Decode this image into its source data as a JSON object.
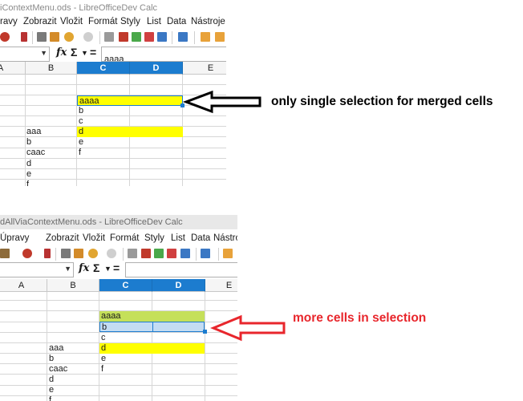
{
  "top": {
    "window_title": "iContextMenu.ods - LibreOfficeDev Calc",
    "menu": [
      "ravy",
      "Zobrazit",
      "Vložit",
      "Formát",
      "Styly",
      "List",
      "Data",
      "Nástroje"
    ],
    "formula_value": "aaaa",
    "columns": [
      "A",
      "B",
      "C",
      "D",
      "E"
    ],
    "cells_b": [
      "aaa",
      "b",
      "caac",
      "d",
      "e",
      "f"
    ],
    "cells_c": [
      "aaaa",
      "b",
      "c",
      "d",
      "e",
      "f"
    ],
    "annotation": "only single selection for merged cells",
    "annotation_color": "#000000",
    "highlight_color": "#ffff00"
  },
  "bottom": {
    "window_title": "dAllViaContextMenu.ods - LibreOfficeDev Calc",
    "menu": [
      "Úpravy",
      "Zobrazit",
      "Vložit",
      "Formát",
      "Styly",
      "List",
      "Data",
      "Nástroje"
    ],
    "columns": [
      "A",
      "B",
      "C",
      "D",
      "E"
    ],
    "cells_b": [
      "aaa",
      "b",
      "caac",
      "d",
      "e",
      "f"
    ],
    "cells_c": [
      "aaaa",
      "b",
      "c",
      "d",
      "e",
      "f"
    ],
    "annotation": "more cells in selection",
    "annotation_color": "#e8262c",
    "selection_color": "#c3dcf3",
    "merged_green": "#c5e05a"
  },
  "icons": [
    "new-document-icon",
    "open-icon",
    "save-icon",
    "print-icon",
    "clone-formatting-icon",
    "undo-icon",
    "redo-icon",
    "find-icon",
    "spelling-icon",
    "row-icon",
    "column-icon",
    "sort-icon",
    "chart-icon",
    "pivot-icon",
    "image-icon"
  ]
}
